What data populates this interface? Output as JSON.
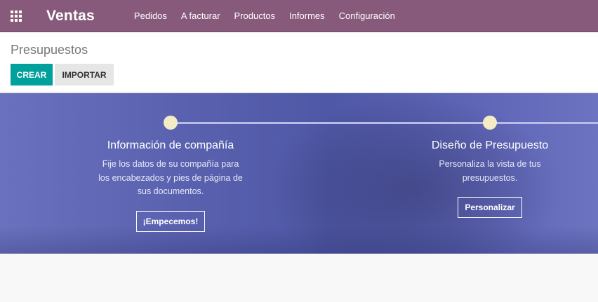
{
  "navbar": {
    "app_name": "Ventas",
    "menu": [
      "Pedidos",
      "A facturar",
      "Productos",
      "Informes",
      "Configuración"
    ],
    "color": "#875a7b"
  },
  "control_panel": {
    "breadcrumb": "Presupuestos",
    "create_label": "CREAR",
    "import_label": "IMPORTAR"
  },
  "onboarding": {
    "steps": [
      {
        "title": "Información de compañía",
        "description_lines": [
          "Fije los datos de su compañía para",
          "los encabezados y pies de página de",
          "sus documentos."
        ],
        "button": "¡Empecemos!"
      },
      {
        "title": "Diseño de Presupuesto",
        "description_lines": [
          "Personaliza la vista de tus",
          "presupuestos."
        ],
        "button": "Personalizar"
      }
    ]
  },
  "icons": {
    "apps": "apps-grid-icon"
  }
}
